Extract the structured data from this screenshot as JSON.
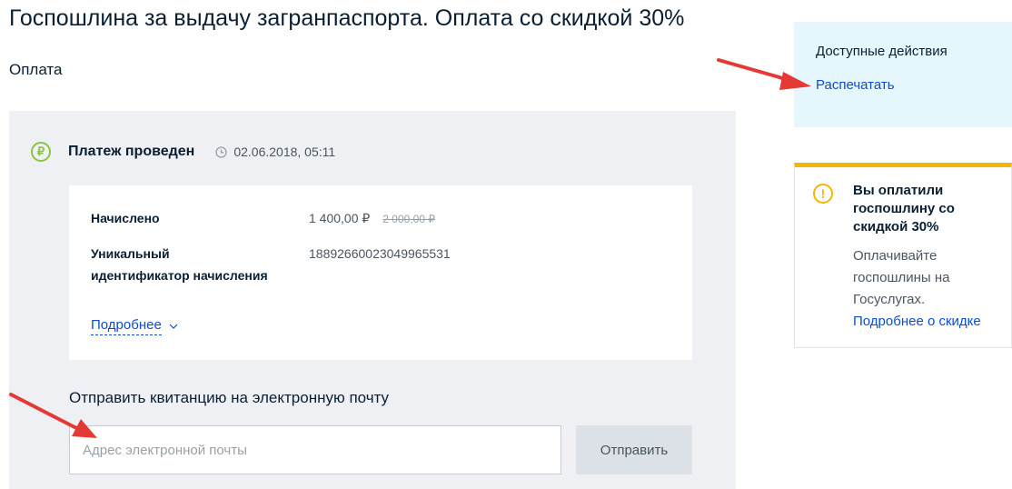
{
  "page": {
    "title": "Госпошлина за выдачу загранпаспорта. Оплата со скидкой 30%",
    "subtitle": "Оплата"
  },
  "payment": {
    "status": "Платеж проведен",
    "datetime": "02.06.2018, 05:11",
    "status_icon": "ruble-icon",
    "time_icon": "clock-icon",
    "status_color": "#8cc43f",
    "charged_label": "Начислено",
    "charged_value": "1 400,00 ₽",
    "charged_old_value": "2 000,00 ₽",
    "uid_label_line1": "Уникальный",
    "uid_label_line2": "идентификатор начисления",
    "uid_value": "18892660023049965531",
    "more_link": "Подробнее"
  },
  "receipt": {
    "title": "Отправить квитанцию на электронную почту",
    "email_placeholder": "Адрес электронной почты",
    "email_value": "",
    "send_label": "Отправить"
  },
  "actions": {
    "title": "Доступные действия",
    "print_link": "Распечатать"
  },
  "notice": {
    "title": "Вы оплатили госпошлину со скидкой 30%",
    "text": "Оплачивайте госпошлины на Госуслугах.",
    "link": "Подробнее о скидке",
    "accent_color": "#f2b705"
  },
  "colors": {
    "link": "#0d4cd3",
    "annotation_arrow": "#e53935"
  }
}
